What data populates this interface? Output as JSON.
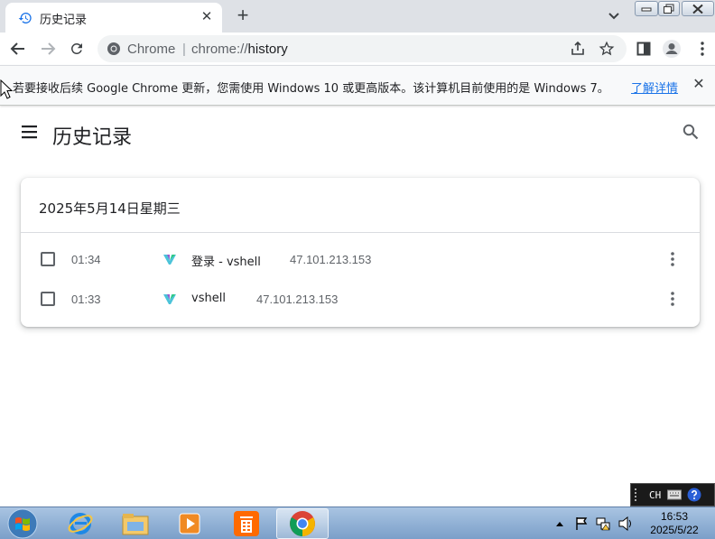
{
  "browser": {
    "tab": {
      "title": "历史记录"
    },
    "omnibox": {
      "origin": "Chrome",
      "separator": "|",
      "url_prefix": "chrome://",
      "url_path": "history"
    }
  },
  "infobar": {
    "message": "若要接收后续 Google Chrome 更新，您需使用 Windows 10 或更高版本。该计算机目前使用的是 Windows 7。",
    "link": "了解详情"
  },
  "page": {
    "title": "历史记录",
    "date_heading": "2025年5月14日星期三",
    "entries": [
      {
        "time": "01:34",
        "title": "登录 - vshell",
        "domain": "47.101.213.153"
      },
      {
        "time": "01:33",
        "title": "vshell",
        "domain": "47.101.213.153"
      }
    ]
  },
  "taskbar": {
    "clock_time": "16:53",
    "clock_date": "2025/5/22",
    "lang": "CH"
  },
  "colors": {
    "accent": "#1a73e8",
    "tabstrip": "#dee1e6"
  }
}
